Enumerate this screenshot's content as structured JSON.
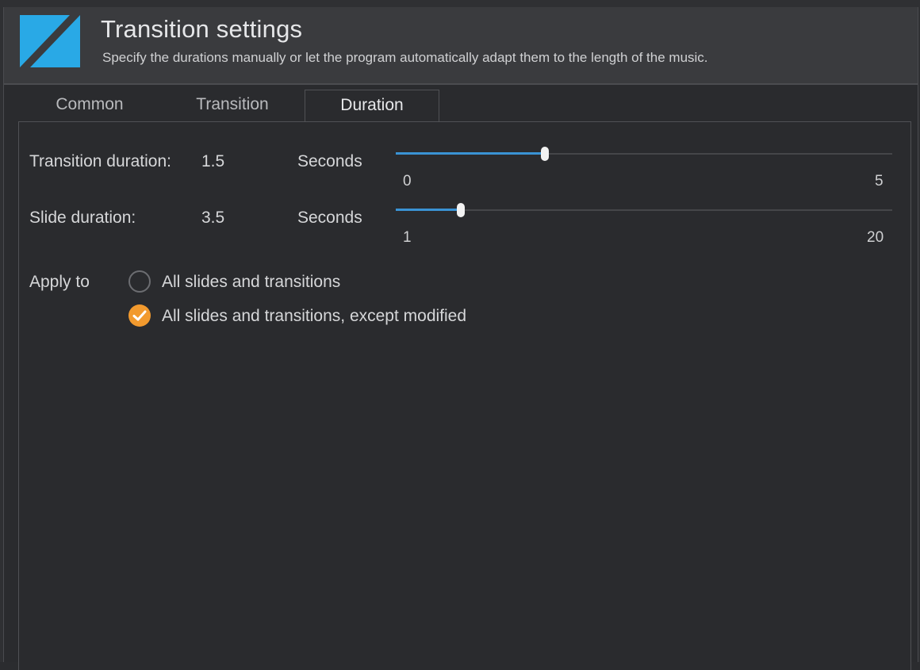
{
  "header": {
    "title": "Transition settings",
    "subtitle": "Specify the durations manually or let the program automatically adapt them to the length of the music.",
    "logo_icon": "transition-logo-icon",
    "logo_color": "#29a9e6"
  },
  "tabs": [
    {
      "label": "Common",
      "selected": false
    },
    {
      "label": "Transition",
      "selected": false
    },
    {
      "label": "Duration",
      "selected": true
    }
  ],
  "transition_duration": {
    "label": "Transition duration:",
    "value": "1.5",
    "unit": "Seconds",
    "min_label": "0",
    "max_label": "5",
    "min": 0,
    "max": 5,
    "current": 1.5
  },
  "slide_duration": {
    "label": "Slide duration:",
    "value": "3.5",
    "unit": "Seconds",
    "min_label": "1",
    "max_label": "20",
    "min": 1,
    "max": 20,
    "current": 3.5
  },
  "apply_to": {
    "label": "Apply to",
    "options": [
      {
        "label": "All slides and transitions",
        "selected": false
      },
      {
        "label": "All slides and transitions, except modified",
        "selected": true
      }
    ]
  },
  "colors": {
    "accent": "#3a93d4",
    "selected_radio": "#f29a2e",
    "background": "#2a2b2e"
  }
}
